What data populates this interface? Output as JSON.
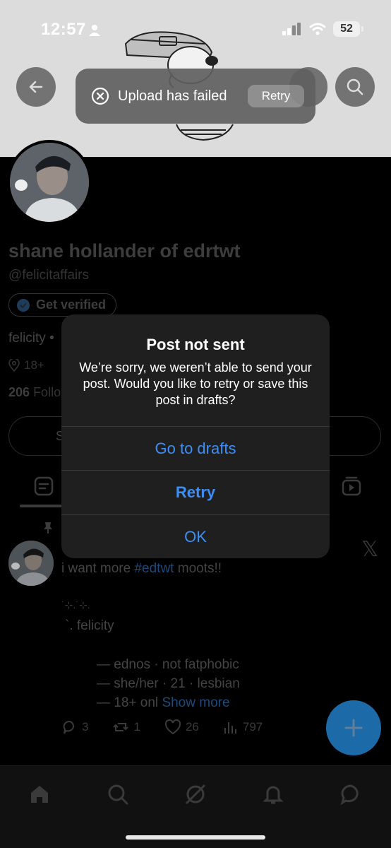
{
  "status_bar": {
    "time": "12:57",
    "battery": "52"
  },
  "toast": {
    "message": "Upload has failed",
    "retry_label": "Retry"
  },
  "profile": {
    "name": "shane hollander of edrtwt",
    "handle": "@felicitaffairs",
    "get_verified_label": "Get verified",
    "bio_start": "felicity •",
    "location": "18+",
    "follow_count": "206",
    "follow_label": "Follo",
    "action_button_partial": "S"
  },
  "post": {
    "text_prefix": "i want more ",
    "hashtag": "#edtwt",
    "text_suffix": " moots!!",
    "deco_line": "˙⊹.˙⊹.",
    "signature": "`. felicity",
    "lines": [
      "— ednos · not fatphobic",
      "— she/her · 21 · lesbian",
      "— 18+ onl"
    ],
    "show_more": "Show more",
    "stats": {
      "replies": "3",
      "reposts": "1",
      "likes": "26",
      "views": "797"
    }
  },
  "dialog": {
    "title": "Post not sent",
    "message": "We’re sorry, we weren’t able to send your post. Would you like to retry or save this post in drafts?",
    "buttons": {
      "drafts": "Go to drafts",
      "retry": "Retry",
      "ok": "OK"
    }
  },
  "colors": {
    "accent": "#3d8ff5",
    "fab": "#1d9bf0",
    "dialog_bg": "#1f1f1f"
  },
  "icons": [
    "back-arrow-icon",
    "search-icon",
    "error-circle-icon",
    "verified-badge-icon",
    "location-pin-icon",
    "posts-tab-icon",
    "video-tab-icon",
    "pin-icon",
    "x-logo-icon",
    "reply-icon",
    "repost-icon",
    "like-icon",
    "views-icon",
    "plus-icon",
    "home-icon",
    "grok-icon",
    "bell-icon",
    "messages-icon"
  ]
}
